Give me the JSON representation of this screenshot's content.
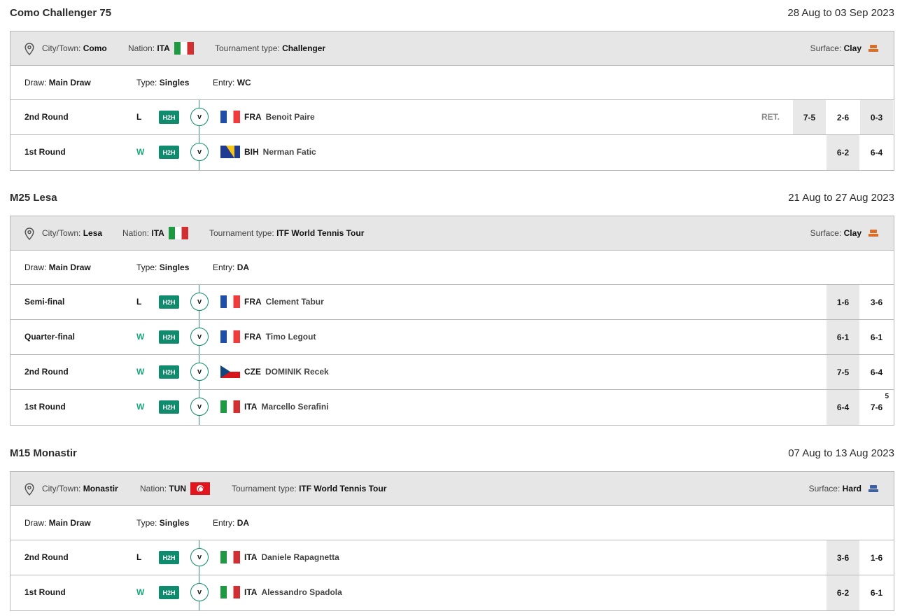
{
  "labels": {
    "city": "City/Town:",
    "nation": "Nation:",
    "tournament_type": "Tournament type:",
    "surface": "Surface:",
    "draw": "Draw:",
    "type": "Type:",
    "entry": "Entry:",
    "h2h": "H2H",
    "vs": "v"
  },
  "tournaments": [
    {
      "name": "Como Challenger 75",
      "dates": "28 Aug to 03 Sep 2023",
      "city": "Como",
      "nation": "ITA",
      "tournament_type": "Challenger",
      "surface": "Clay",
      "surface_color": "#d8702c",
      "draw": "Main Draw",
      "type": "Singles",
      "entry": "WC",
      "matches": [
        {
          "round": "2nd Round",
          "result": "L",
          "nat": "FRA",
          "opponent": "Benoit Paire",
          "ret": "RET.",
          "sets": [
            "7-5",
            "2-6",
            "0-3"
          ]
        },
        {
          "round": "1st Round",
          "result": "W",
          "nat": "BIH",
          "opponent": "Nerman Fatic",
          "sets": [
            "6-2",
            "6-4"
          ]
        }
      ]
    },
    {
      "name": "M25 Lesa",
      "dates": "21 Aug to 27 Aug 2023",
      "city": "Lesa",
      "nation": "ITA",
      "tournament_type": "ITF World Tennis Tour",
      "surface": "Clay",
      "surface_color": "#d8702c",
      "draw": "Main Draw",
      "type": "Singles",
      "entry": "DA",
      "matches": [
        {
          "round": "Semi-final",
          "result": "L",
          "nat": "FRA",
          "opponent": "Clement Tabur",
          "sets": [
            "1-6",
            "3-6"
          ]
        },
        {
          "round": "Quarter-final",
          "result": "W",
          "nat": "FRA",
          "opponent": "Timo Legout",
          "sets": [
            "6-1",
            "6-1"
          ]
        },
        {
          "round": "2nd Round",
          "result": "W",
          "nat": "CZE",
          "opponent": "DOMINIK Recek",
          "sets": [
            "7-5",
            "6-4"
          ]
        },
        {
          "round": "1st Round",
          "result": "W",
          "nat": "ITA",
          "opponent": "Marcello Serafini",
          "sets": [
            "6-4",
            "7-6"
          ],
          "tiebreak": "5"
        }
      ]
    },
    {
      "name": "M15 Monastir",
      "dates": "07 Aug to 13 Aug 2023",
      "city": "Monastir",
      "nation": "TUN",
      "tournament_type": "ITF World Tennis Tour",
      "surface": "Hard",
      "surface_color": "#3d5fa8",
      "draw": "Main Draw",
      "type": "Singles",
      "entry": "DA",
      "matches": [
        {
          "round": "2nd Round",
          "result": "L",
          "nat": "ITA",
          "opponent": "Daniele Rapagnetta",
          "sets": [
            "3-6",
            "1-6"
          ]
        },
        {
          "round": "1st Round",
          "result": "W",
          "nat": "ITA",
          "opponent": "Alessandro Spadola",
          "sets": [
            "6-2",
            "6-1"
          ]
        }
      ]
    }
  ]
}
